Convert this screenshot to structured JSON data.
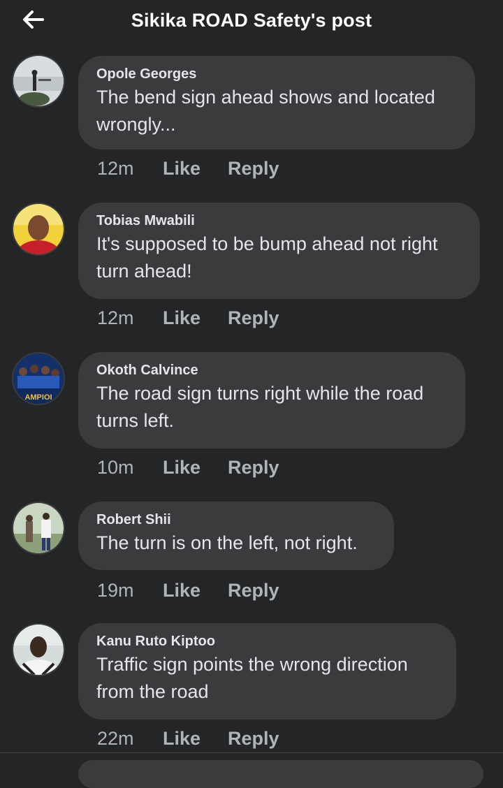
{
  "header": {
    "title": "Sikika ROAD Safety's post",
    "back_icon": "back-arrow-icon"
  },
  "comments": [
    {
      "author": "Opole Georges",
      "text": "The bend sign ahead shows and located wrongly...",
      "time": "12m",
      "like_label": "Like",
      "reply_label": "Reply"
    },
    {
      "author": "Tobias Mwabili",
      "text": "It's supposed to be bump ahead not right turn ahead!",
      "time": "12m",
      "like_label": "Like",
      "reply_label": "Reply"
    },
    {
      "author": "Okoth Calvince",
      "text": "The road sign turns right while the road turns left.",
      "time": "10m",
      "like_label": "Like",
      "reply_label": "Reply",
      "avatar_text": "AMPIOI"
    },
    {
      "author": "Robert Shii",
      "text": "The turn is on the left, not right.",
      "time": "19m",
      "like_label": "Like",
      "reply_label": "Reply"
    },
    {
      "author": "Kanu Ruto Kiptoo",
      "text": "Traffic sign points the wrong direction from the road",
      "time": "22m",
      "like_label": "Like",
      "reply_label": "Reply"
    }
  ],
  "colors": {
    "background": "#242527",
    "bubble": "#3a3b3c",
    "primary_text": "#e4e6eb",
    "secondary_text": "#b0b3b8"
  }
}
